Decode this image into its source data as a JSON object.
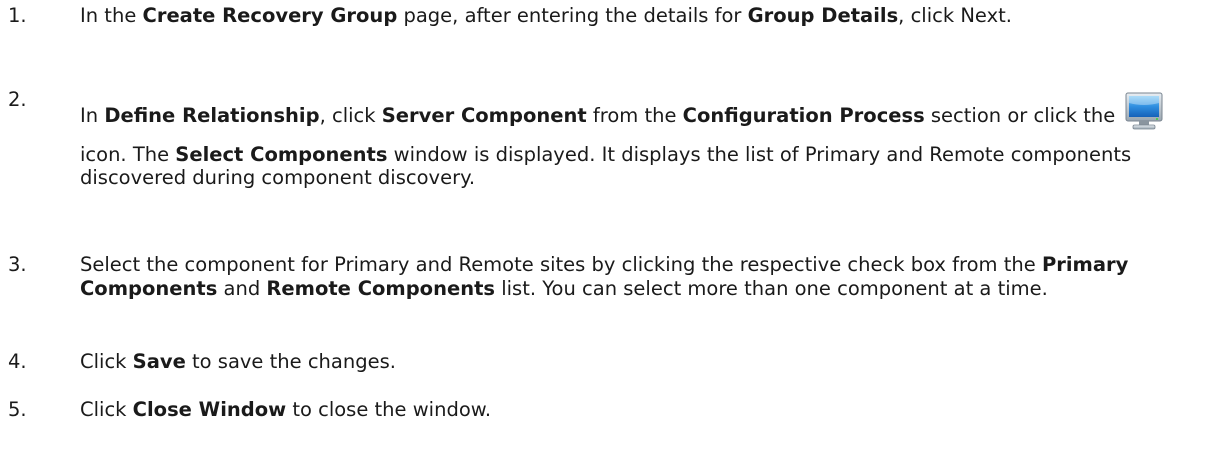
{
  "steps": [
    {
      "num": "1.",
      "t1": "In the ",
      "b1": "Create Recovery Group",
      "t2": " page, after entering the details for ",
      "b2": "Group Details",
      "t3": ", click Next."
    },
    {
      "num": "2.",
      "t1": "In ",
      "b1": "Define Relationship",
      "t2": ", click ",
      "b2": "Server Component",
      "t3": " from the ",
      "b3": "Configuration Process",
      "t4": " section or click the ",
      "icon": "computer-monitor-icon",
      "t5": " icon.  The ",
      "b4": "Select Components",
      "t6": " window is displayed. It displays the list of Primary and Remote components discovered during component discovery."
    },
    {
      "num": "3.",
      "t1": "Select the component for Primary and Remote sites by clicking the respective check box from the ",
      "b1": "Primary Components",
      "t2": " and ",
      "b2": "Remote Components",
      "t3": " list. You can select more than one component at a time."
    },
    {
      "num": "4.",
      "t1": "Click ",
      "b1": "Save",
      "t2": " to save the changes."
    },
    {
      "num": "5.",
      "t1": "Click ",
      "b1": "Close Window",
      "t2": " to close the window."
    }
  ]
}
